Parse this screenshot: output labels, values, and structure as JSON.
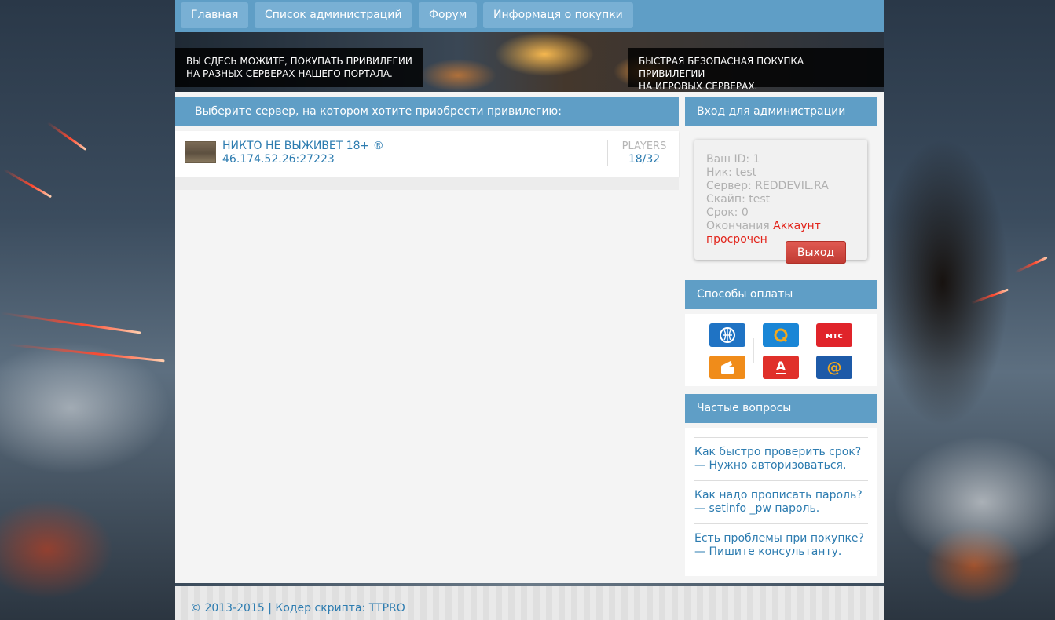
{
  "nav": {
    "items": [
      {
        "label": "Главная"
      },
      {
        "label": "Список администраций"
      },
      {
        "label": "Форум"
      },
      {
        "label": "Информаця о покупки"
      }
    ]
  },
  "banner": {
    "left_line1": "ВЫ СДЕСЬ МОЖИТЕ, ПОКУПАТЬ ПРИВИЛЕГИИ",
    "left_line2": "НА РАЗНЫХ СЕРВЕРАХ НАШЕГО ПОРТАЛА.",
    "right_line1": "БЫСТРАЯ БЕЗОПАСНАЯ ПОКУПКА ПРИВИЛЕГИИ",
    "right_line2": "НА ИГРОВЫХ СЕРВЕРАХ."
  },
  "servers": {
    "heading": "Выберите сервер, на котором хотите приобрести привилегию:",
    "list": [
      {
        "name": "НИКТО НЕ ВЫЖИВЕТ 18+ ®",
        "address": "46.174.52.26:27223",
        "players_label": "PLAYERS",
        "players": "18/32"
      }
    ]
  },
  "admin": {
    "heading": "Вход для администрации",
    "id_line": "Ваш ID: 1",
    "nick_line": "Ник: test",
    "server_line": "Сервер: REDDEVIL.RA",
    "skype_line": "Скайп: test",
    "term_line": "Срок: 0",
    "expiry_label": "Окончания",
    "expiry_status_1": "Аккаунт",
    "expiry_status_2": "просрочен",
    "logout_label": "Выход"
  },
  "payments": {
    "heading": "Способы оплаты",
    "methods": [
      {
        "icon": "webmoney-icon",
        "color": "#1f73c4"
      },
      {
        "icon": "qiwi-icon",
        "color": "#1a86d6",
        "glyph": "Q"
      },
      {
        "icon": "mts-icon",
        "color": "#e0242a",
        "glyph": "мтс"
      },
      {
        "icon": "yandex-money-icon",
        "color": "#f08c1a"
      },
      {
        "icon": "alfa-bank-icon",
        "color": "#e0302a",
        "glyph": "А"
      },
      {
        "icon": "mail-money-icon",
        "color": "#1d5aa8",
        "glyph": "@"
      }
    ]
  },
  "faq": {
    "heading": "Частые вопросы",
    "items": [
      {
        "question": "Как быстро проверить срок?",
        "answer": "— Нужно авторизоваться."
      },
      {
        "question": "Как надо прописать пароль?",
        "answer": "— setinfo _pw пароль."
      },
      {
        "question": "Есть проблемы при покупке?",
        "answer": "— Пишите консультанту."
      }
    ]
  },
  "footer": {
    "text": "© 2013-2015 | Кодер скрипта: TTPRO"
  }
}
